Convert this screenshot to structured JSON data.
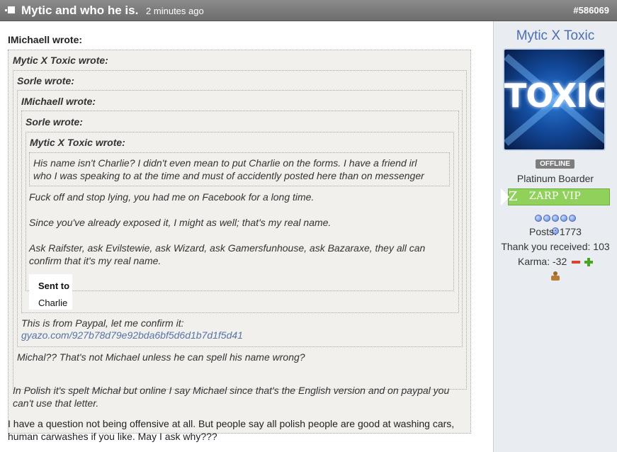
{
  "post": {
    "title": "Mytic and who he is.",
    "time": "2 minutes ago",
    "number": "#586069"
  },
  "quotes": {
    "q1_author": "IMichaell wrote:",
    "q2_author": "Mytic X Toxic wrote:",
    "q3_author": "Sorle wrote:",
    "q4_author": "IMichaell wrote:",
    "q5_author": "Sorle wrote:",
    "q6_author": "Mytic X Toxic wrote:",
    "q6_text_1": "His name isn't Charlie? I didn't even mean to put Charlie on the forms. I have a friend irl",
    "q6_text_2": "who I was speaking to at the time and must of accidently posted here than on messenger",
    "q5_text_1": "Fuck off and stop lying, you had me on Facebook for a long time.",
    "q5_text_2": "Since you've already exposed it, I might as well; that's my real name.",
    "q5_text_3": "Ask Raifster, ask Evilstewie, ask Wizard, ask Gamersfunhouse, ask Bazaraxe, they all can",
    "q5_text_4": "confirm that it's my real name.",
    "image_line1": "Sent to",
    "image_line2": "Charlie",
    "q3_text": "This is from Paypal, let me confirm it:",
    "q3_link": "gyazo.com/927b78d79e92bda6bf5d6d1b7d1f5d41",
    "q2_text": "Michal?? That's not Michael unless he can spell his name wrong?",
    "q1_text_1": "In Polish it's spelt Michał but online I say Michael since that's the English version and on paypal you",
    "q1_text_2": "can't use that letter."
  },
  "body": {
    "line1": "I have a question not being offensive at all. But people say all polish people are good at washing cars,",
    "line2": "human carwashes if you like. May I ask why???"
  },
  "user": {
    "name": "Mytic X Toxic",
    "avatar_text": "TOXIC",
    "status": "OFFLINE",
    "rank": "Platinum Boarder",
    "badge_letter": "Z",
    "badge": "ZARP VIP",
    "posts": "Posts: 1773",
    "thanks": "Thank you received: 103",
    "karma": "Karma: -32"
  },
  "icons": [
    "collapse-icon",
    "karma-minus-icon",
    "karma-plus-icon",
    "stamp-icon"
  ],
  "colors": {
    "header": "#7a7a7a",
    "link": "#5573a8",
    "username": "#4c6fb2",
    "vip": "#8fd15b"
  }
}
